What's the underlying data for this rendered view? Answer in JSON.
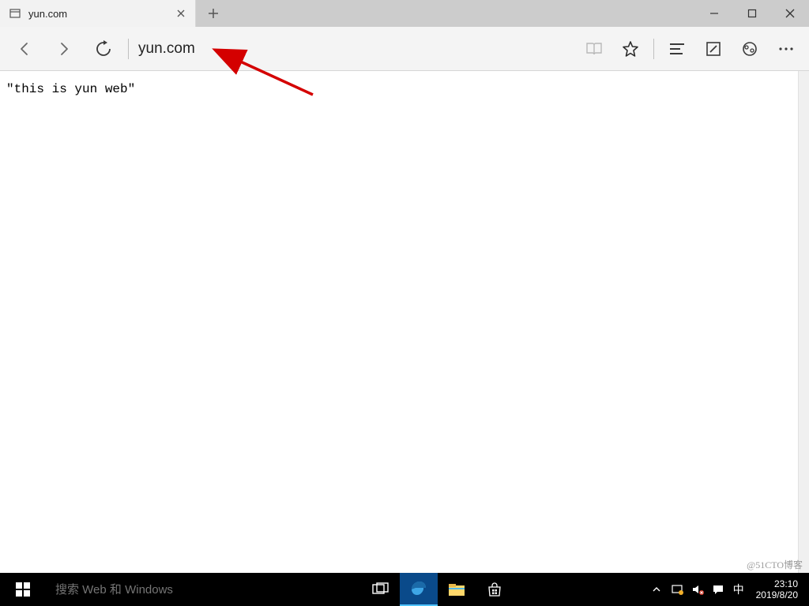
{
  "tab": {
    "title": "yun.com"
  },
  "toolbar": {
    "url": "yun.com"
  },
  "page": {
    "body_text": "\"this is yun web\""
  },
  "taskbar": {
    "search_placeholder": "搜索 Web 和 Windows",
    "ime_indicator": "中",
    "clock_time": "23:10",
    "clock_date": "2019/8/20"
  },
  "watermark": "@51CTO博客"
}
